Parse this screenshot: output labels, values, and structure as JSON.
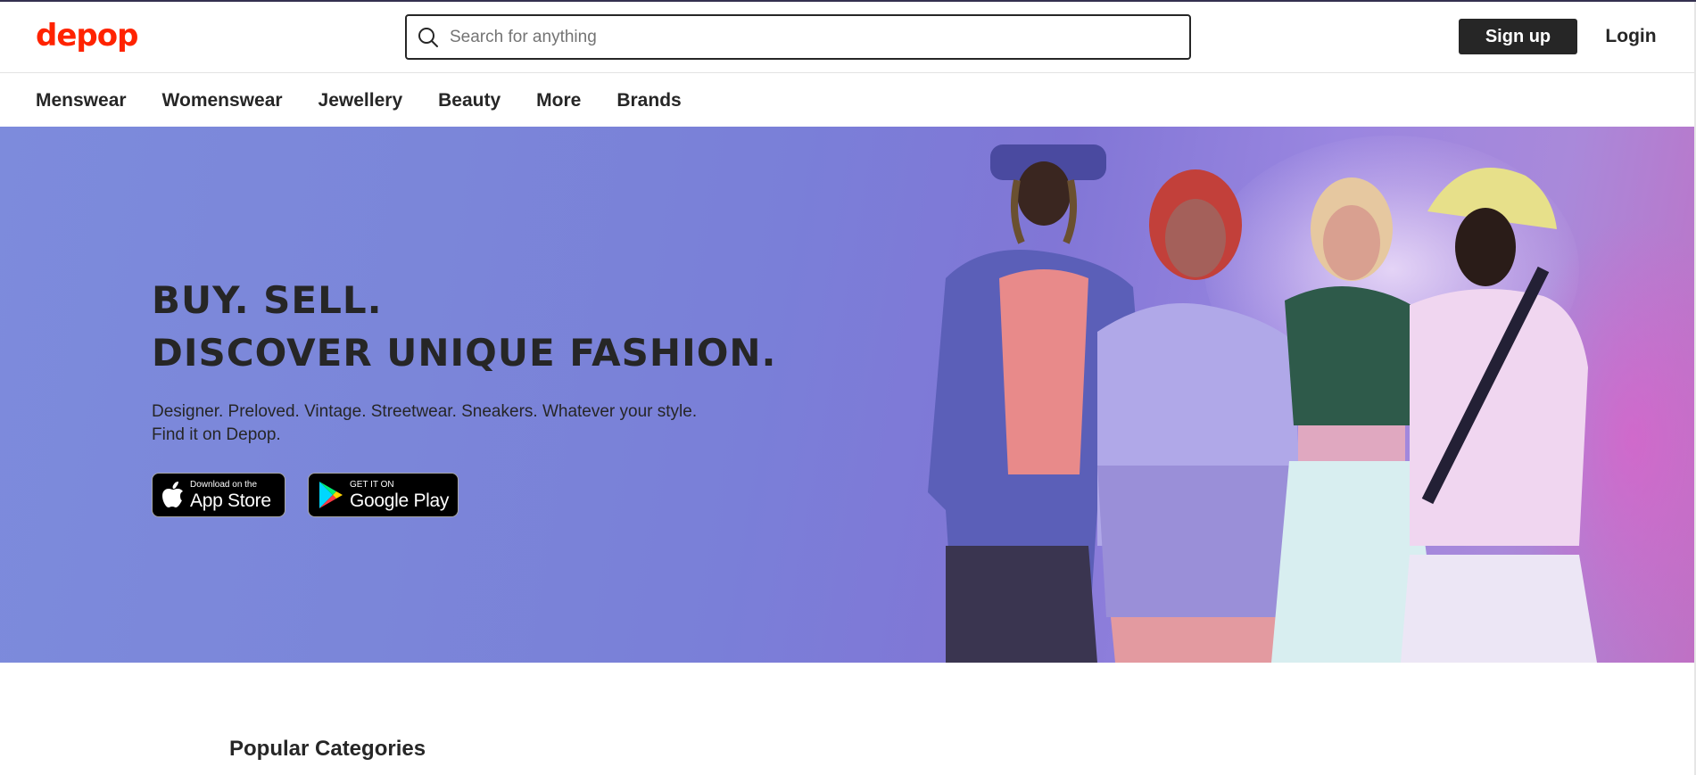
{
  "header": {
    "logo": "depop",
    "search_placeholder": "Search for anything",
    "signup_label": "Sign up",
    "login_label": "Login"
  },
  "nav": {
    "items": [
      {
        "label": "Menswear"
      },
      {
        "label": "Womenswear"
      },
      {
        "label": "Jewellery"
      },
      {
        "label": "Beauty"
      },
      {
        "label": "More"
      },
      {
        "label": "Brands"
      }
    ]
  },
  "hero": {
    "title_line1": "BUY. SELL.",
    "title_line2": "DISCOVER UNIQUE FASHION.",
    "subtitle": "Designer. Preloved. Vintage. Streetwear. Sneakers. Whatever your style. Find it on Depop.",
    "app_store": {
      "small": "Download on the",
      "big": "App Store"
    },
    "google_play": {
      "small": "GET IT ON",
      "big": "Google Play"
    }
  },
  "sections": {
    "popular_categories": "Popular Categories"
  },
  "colors": {
    "brand": "#ff2300",
    "text": "#262626",
    "hero_bg": "#7b86d9"
  }
}
